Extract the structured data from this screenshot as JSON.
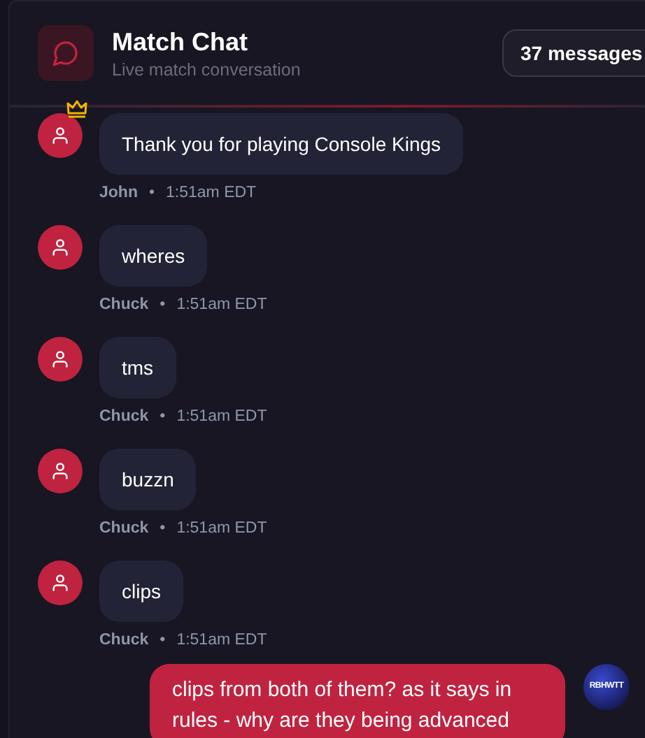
{
  "header": {
    "title": "Match Chat",
    "subtitle": "Live match conversation",
    "count_badge": "37 messages"
  },
  "messages": [
    {
      "kind": "other",
      "crown": true,
      "text": "Thank you for playing Console Kings",
      "author": "John",
      "separator": "•",
      "time": "1:51am EDT"
    },
    {
      "kind": "other",
      "crown": false,
      "text": "wheres",
      "author": "Chuck",
      "separator": "•",
      "time": "1:51am EDT"
    },
    {
      "kind": "other",
      "crown": false,
      "text": "tms",
      "author": "Chuck",
      "separator": "•",
      "time": "1:51am EDT"
    },
    {
      "kind": "other",
      "crown": false,
      "text": "buzzn",
      "author": "Chuck",
      "separator": "•",
      "time": "1:51am EDT"
    },
    {
      "kind": "other",
      "crown": false,
      "text": "clips",
      "author": "Chuck",
      "separator": "•",
      "time": "1:51am EDT"
    },
    {
      "kind": "own",
      "text": "clips from both of them? as it says in rules - why are they being advanced",
      "avatar_text": "RBHWTT"
    }
  ]
}
